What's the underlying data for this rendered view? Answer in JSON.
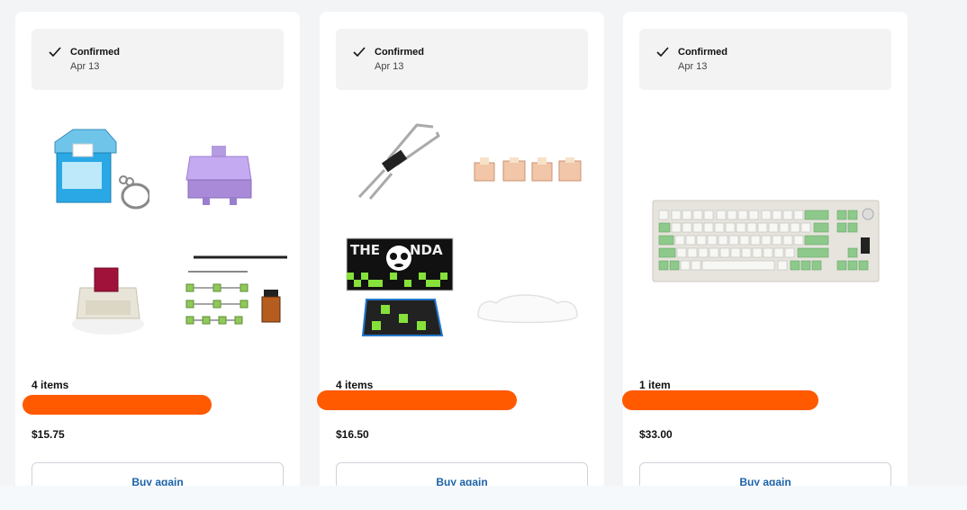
{
  "orders": [
    {
      "status": {
        "label": "Confirmed",
        "date": "Apr 13"
      },
      "item_count": "4 items",
      "price": "$15.75",
      "buy_again_label": "Buy again",
      "thumbnails": [
        "keyswitch-keychain",
        "purple-switch",
        "red-switch",
        "stabilizer-kit"
      ]
    },
    {
      "status": {
        "label": "Confirmed",
        "date": "Apr 13"
      },
      "item_count": "4 items",
      "price": "$16.50",
      "buy_again_label": "Buy again",
      "thumbnails": [
        "switch-puller",
        "peach-switches",
        "panda-desk-mat",
        "cloud-wrist-rest"
      ],
      "mat_text": "THE PANDA"
    },
    {
      "status": {
        "label": "Confirmed",
        "date": "Apr 13"
      },
      "item_count": "1 item",
      "price": "$33.00",
      "buy_again_label": "Buy again",
      "thumbnails": [
        "mechanical-keyboard"
      ]
    }
  ],
  "colors": {
    "accent": "#1b62a8",
    "redaction": "#ff5a00",
    "status_bg": "#f3f3f3",
    "keyboard_accent": "#8cc98a"
  }
}
